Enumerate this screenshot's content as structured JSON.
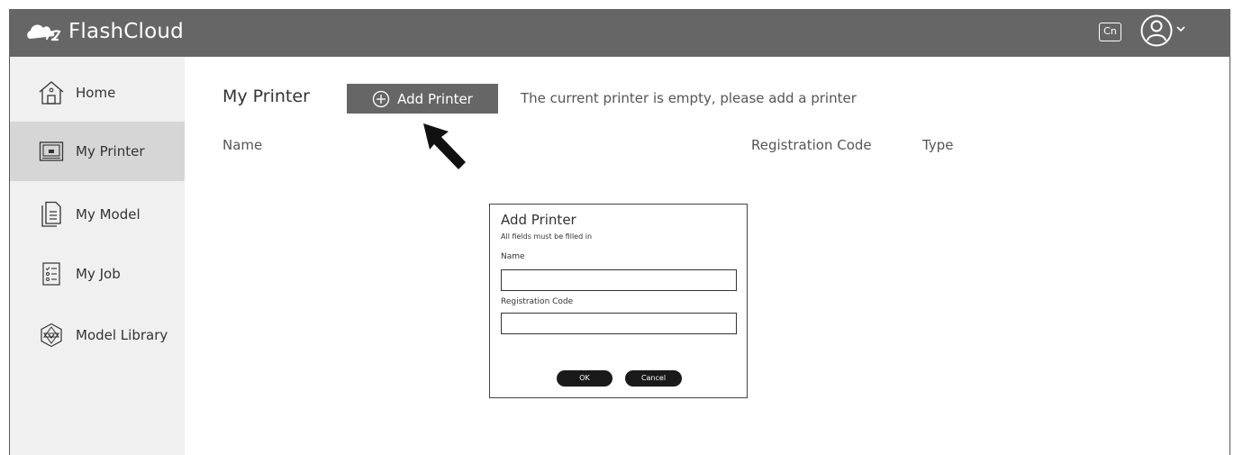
{
  "app": {
    "title": "FlashCloud",
    "lang_label": "Cn"
  },
  "sidebar": {
    "items": [
      {
        "label": "Home",
        "icon": "home-icon",
        "active": false
      },
      {
        "label": "My Printer",
        "icon": "printer-icon",
        "active": true
      },
      {
        "label": "My Model",
        "icon": "document-icon",
        "active": false
      },
      {
        "label": "My Job",
        "icon": "checklist-icon",
        "active": false
      },
      {
        "label": "Model Library",
        "icon": "model-library-icon",
        "active": false
      }
    ]
  },
  "main": {
    "title": "My Printer",
    "add_button_label": "Add Printer",
    "empty_message": "The current printer is empty, please add a printer",
    "columns": [
      "Name",
      "Registration Code",
      "Type"
    ]
  },
  "dialog": {
    "title": "Add Printer",
    "subtitle": "All fields must be filled in",
    "name_label": "Name",
    "name_value": "",
    "reg_label": "Registration Code",
    "reg_value": "",
    "ok_label": "OK",
    "cancel_label": "Cancel"
  },
  "colors": {
    "topbar": "#666666",
    "sidebar": "#f0f0f0",
    "sidebar_active": "#d6d6d6",
    "button": "#666666"
  }
}
